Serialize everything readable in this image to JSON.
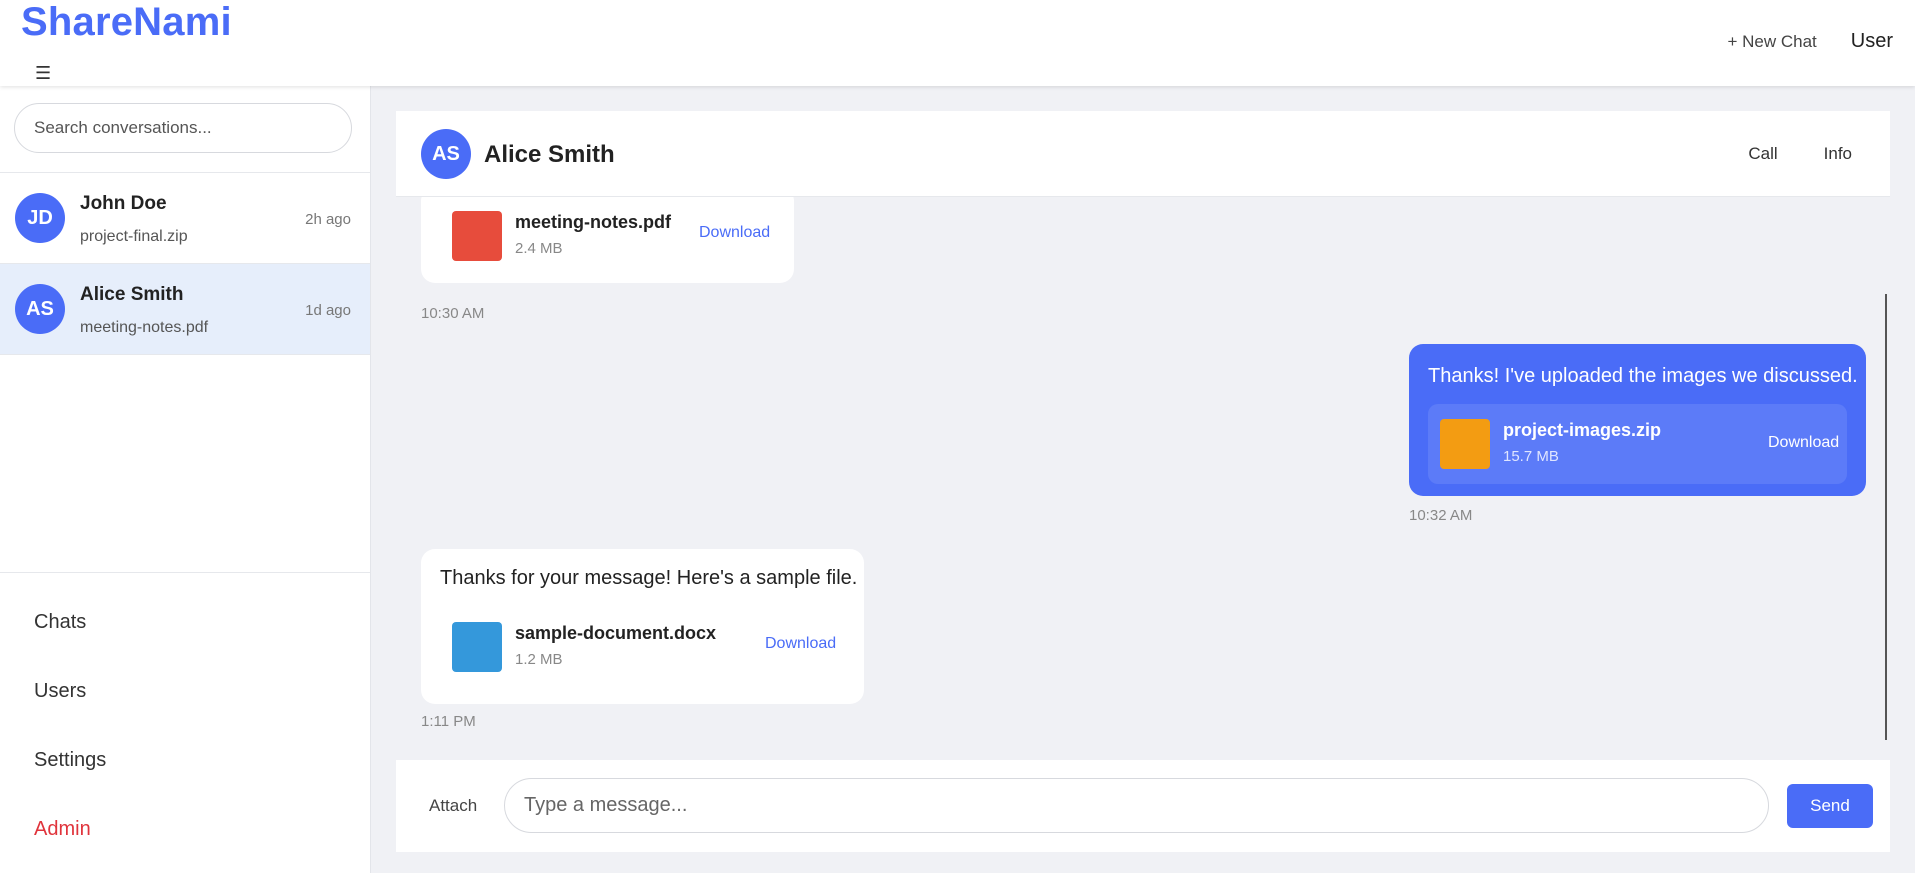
{
  "app": {
    "brand": "ShareNami",
    "menu_icon": "☰"
  },
  "header": {
    "new_chat_label": "+ New Chat",
    "user_label": "User"
  },
  "sidebar": {
    "search_placeholder": "Search conversations...",
    "conversations": [
      {
        "initials": "JD",
        "name": "John Doe",
        "last_file": "project-final.zip",
        "time": "2h ago",
        "active": false
      },
      {
        "initials": "AS",
        "name": "Alice Smith",
        "last_file": "meeting-notes.pdf",
        "time": "1d ago",
        "active": true
      }
    ],
    "nav": [
      {
        "label": "Chats"
      },
      {
        "label": "Users"
      },
      {
        "label": "Settings"
      },
      {
        "label": "Admin"
      }
    ]
  },
  "chat": {
    "initials": "AS",
    "title": "Alice Smith",
    "call_label": "Call",
    "info_label": "Info",
    "messages": [
      {
        "direction": "in",
        "text": "",
        "file": {
          "name": "meeting-notes.pdf",
          "size": "2.4 MB",
          "color": "#e74c3c",
          "download": "Download"
        },
        "time": "10:30 AM"
      },
      {
        "direction": "out",
        "text": "Thanks! I've uploaded the images we discussed.",
        "file": {
          "name": "project-images.zip",
          "size": "15.7 MB",
          "color": "#f39c12",
          "download": "Download"
        },
        "time": "10:32 AM"
      },
      {
        "direction": "in",
        "text": "Thanks for your message! Here's a sample file.",
        "file": {
          "name": "sample-document.docx",
          "size": "1.2 MB",
          "color": "#3498db",
          "download": "Download"
        },
        "time": "1:11 PM"
      }
    ]
  },
  "composer": {
    "attach_label": "Attach",
    "placeholder": "Type a message...",
    "send_label": "Send"
  }
}
